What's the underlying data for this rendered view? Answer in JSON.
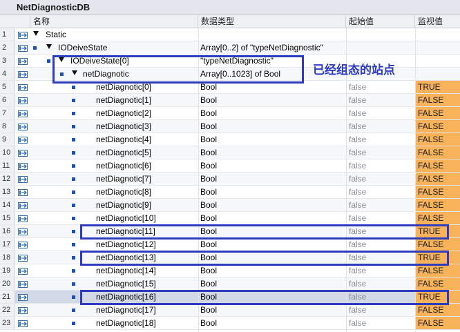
{
  "window": {
    "title": "NetDiagnosticDB"
  },
  "columns": {
    "name": "名称",
    "data_type": "数据类型",
    "start_value": "起始值",
    "monitor_value": "监视值"
  },
  "annotation": "已经组态的站点",
  "colors": {
    "highlight_border": "#2d3bbf",
    "monitor_fill": "#f7b25a"
  },
  "rows": [
    {
      "num": "1",
      "icon": "db-in-out-icon",
      "level": 0,
      "name": "Static",
      "type": "",
      "start": "",
      "monitor": ""
    },
    {
      "num": "2",
      "icon": "db-in-out-icon",
      "level": 1,
      "name": "IODeiveState",
      "type": "Array[0..2] of \"typeNetDiagnostic\"",
      "start": "",
      "monitor": ""
    },
    {
      "num": "3",
      "icon": "db-in-out-icon",
      "level": 2,
      "name": "IODeiveState[0]",
      "type": "\"typeNetDiagnostic\"",
      "start": "",
      "monitor": ""
    },
    {
      "num": "4",
      "icon": "db-in-out-icon",
      "level": 3,
      "name": "netDiagnotic",
      "type": "Array[0..1023] of Bool",
      "start": "",
      "monitor": ""
    },
    {
      "num": "5",
      "icon": "db-in-out-icon",
      "level": 4,
      "name": "netDiagnotic[0]",
      "type": "Bool",
      "start": "false",
      "monitor": "TRUE"
    },
    {
      "num": "6",
      "icon": "db-in-out-icon",
      "level": 4,
      "name": "netDiagnotic[1]",
      "type": "Bool",
      "start": "false",
      "monitor": "FALSE"
    },
    {
      "num": "7",
      "icon": "db-in-out-icon",
      "level": 4,
      "name": "netDiagnotic[2]",
      "type": "Bool",
      "start": "false",
      "monitor": "FALSE"
    },
    {
      "num": "8",
      "icon": "db-in-out-icon",
      "level": 4,
      "name": "netDiagnotic[3]",
      "type": "Bool",
      "start": "false",
      "monitor": "FALSE"
    },
    {
      "num": "9",
      "icon": "db-in-out-icon",
      "level": 4,
      "name": "netDiagnotic[4]",
      "type": "Bool",
      "start": "false",
      "monitor": "FALSE"
    },
    {
      "num": "10",
      "icon": "db-in-out-icon",
      "level": 4,
      "name": "netDiagnotic[5]",
      "type": "Bool",
      "start": "false",
      "monitor": "FALSE"
    },
    {
      "num": "11",
      "icon": "db-in-out-icon",
      "level": 4,
      "name": "netDiagnotic[6]",
      "type": "Bool",
      "start": "false",
      "monitor": "FALSE"
    },
    {
      "num": "12",
      "icon": "db-in-out-icon",
      "level": 4,
      "name": "netDiagnotic[7]",
      "type": "Bool",
      "start": "false",
      "monitor": "FALSE"
    },
    {
      "num": "13",
      "icon": "db-in-out-icon",
      "level": 4,
      "name": "netDiagnotic[8]",
      "type": "Bool",
      "start": "false",
      "monitor": "FALSE"
    },
    {
      "num": "14",
      "icon": "db-in-out-icon",
      "level": 4,
      "name": "netDiagnotic[9]",
      "type": "Bool",
      "start": "false",
      "monitor": "FALSE"
    },
    {
      "num": "15",
      "icon": "db-in-out-icon",
      "level": 4,
      "name": "netDiagnotic[10]",
      "type": "Bool",
      "start": "false",
      "monitor": "FALSE"
    },
    {
      "num": "16",
      "icon": "db-in-out-icon",
      "level": 4,
      "name": "netDiagnotic[11]",
      "type": "Bool",
      "start": "false",
      "monitor": "TRUE"
    },
    {
      "num": "17",
      "icon": "db-in-out-icon",
      "level": 4,
      "name": "netDiagnotic[12]",
      "type": "Bool",
      "start": "false",
      "monitor": "FALSE"
    },
    {
      "num": "18",
      "icon": "db-in-out-icon",
      "level": 4,
      "name": "netDiagnotic[13]",
      "type": "Bool",
      "start": "false",
      "monitor": "TRUE"
    },
    {
      "num": "19",
      "icon": "db-in-out-icon",
      "level": 4,
      "name": "netDiagnotic[14]",
      "type": "Bool",
      "start": "false",
      "monitor": "FALSE"
    },
    {
      "num": "20",
      "icon": "db-in-out-icon",
      "level": 4,
      "name": "netDiagnotic[15]",
      "type": "Bool",
      "start": "false",
      "monitor": "FALSE"
    },
    {
      "num": "21",
      "icon": "db-in-out-icon",
      "level": 4,
      "name": "netDiagnotic[16]",
      "type": "Bool",
      "start": "false",
      "monitor": "TRUE",
      "selected": true
    },
    {
      "num": "22",
      "icon": "db-in-out-icon",
      "level": 4,
      "name": "netDiagnotic[17]",
      "type": "Bool",
      "start": "false",
      "monitor": "FALSE"
    },
    {
      "num": "23",
      "icon": "db-in-out-icon",
      "level": 4,
      "name": "netDiagnotic[18]",
      "type": "Bool",
      "start": "false",
      "monitor": "FALSE"
    }
  ]
}
